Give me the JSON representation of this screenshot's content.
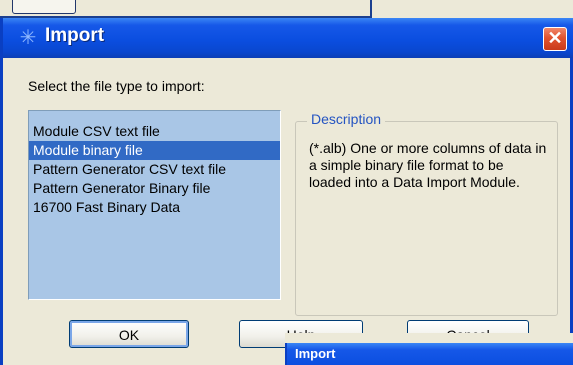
{
  "dialog": {
    "title": "Import",
    "close_glyph": "✕",
    "prompt": "Select the file type to import:",
    "file_types": [
      {
        "label": "Module CSV text file",
        "selected": false
      },
      {
        "label": "Module binary file",
        "selected": true
      },
      {
        "label": "Pattern Generator CSV text file",
        "selected": false
      },
      {
        "label": "Pattern Generator Binary file",
        "selected": false
      },
      {
        "label": "16700 Fast Binary Data",
        "selected": false
      }
    ],
    "description": {
      "legend": "Description",
      "text": "(*.alb) One or more columns of data in a simple binary file format to be loaded into a Data Import Module."
    },
    "buttons": {
      "ok": "OK",
      "help": "Help",
      "cancel": "Cancel"
    }
  },
  "second_window": {
    "title": "Import"
  },
  "icons": {
    "title_icon": "app-logo-icon",
    "close_icon": "close-icon"
  },
  "colors": {
    "titlebar": "#0b4ee0",
    "selection": "#316ac5",
    "list_background": "#a9c6e6",
    "legend_text": "#2454c2",
    "close_button": "#e2532f"
  }
}
